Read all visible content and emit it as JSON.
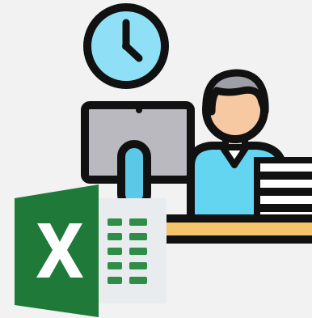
{
  "illustration": {
    "colors": {
      "background": "#f2f2f2",
      "outline": "#111111",
      "clock_face": "#8fe0f7",
      "monitor_screen": "#b9b9bf",
      "monitor_stand": "#5cc8e8",
      "skin": "#f7c9a3",
      "hair": "#9e9ea6",
      "shirt": "#63d5f0",
      "desk": "#f6c46a",
      "paper": "#ffffff",
      "excel_green": "#1f7a3a",
      "excel_sheet": "#e8ecef",
      "excel_cell": "#2f8d48"
    },
    "icons": [
      "clock-icon",
      "monitor-icon",
      "person-icon",
      "paper-stack-icon",
      "desk-icon",
      "excel-icon"
    ]
  }
}
